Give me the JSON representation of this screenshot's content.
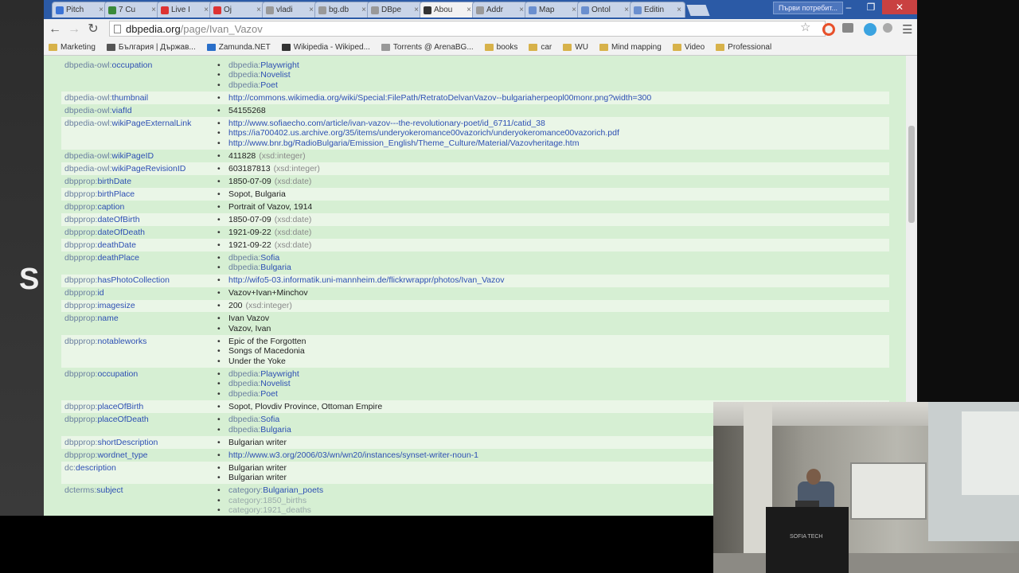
{
  "browser": {
    "tabs": [
      {
        "label": "Pitch",
        "icon_color": "#3b73d6"
      },
      {
        "label": "7 Cu",
        "icon_color": "#3a8a3a"
      },
      {
        "label": "Live I",
        "icon_color": "#d33"
      },
      {
        "label": "Oj",
        "icon_color": "#d33"
      },
      {
        "label": "vladi",
        "icon_color": "#999"
      },
      {
        "label": "bg.db",
        "icon_color": "#999"
      },
      {
        "label": "DBpe",
        "icon_color": "#999"
      },
      {
        "label": "Abou",
        "icon_color": "#333",
        "active": true
      },
      {
        "label": "Addr",
        "icon_color": "#999"
      },
      {
        "label": "Map",
        "icon_color": "#6a8fcf"
      },
      {
        "label": "Ontol",
        "icon_color": "#6a8fcf"
      },
      {
        "label": "Editin",
        "icon_color": "#6a8fcf"
      }
    ],
    "user_chip": "Първи потребит...",
    "url_host": "dbpedia.org",
    "url_path": "/page/Ivan_Vazov",
    "bookmarks": [
      {
        "label": "Marketing",
        "color": "#d7b24a"
      },
      {
        "label": "България | Държав...",
        "color": "#555"
      },
      {
        "label": "Zamunda.NET",
        "color": "#2a6fc9"
      },
      {
        "label": "Wikipedia - Wikiped...",
        "color": "#333"
      },
      {
        "label": "Torrents @ ArenaBG...",
        "color": "#999"
      },
      {
        "label": "books",
        "color": "#d7b24a"
      },
      {
        "label": "car",
        "color": "#d7b24a"
      },
      {
        "label": "WU",
        "color": "#d7b24a"
      },
      {
        "label": "Mind mapping",
        "color": "#d7b24a"
      },
      {
        "label": "Video",
        "color": "#d7b24a"
      },
      {
        "label": "Professional",
        "color": "#d7b24a"
      }
    ]
  },
  "slide_letter": "S",
  "podium_label": "SOFIA TECH",
  "rows": [
    {
      "prefix": "dbpedia-owl:",
      "local": "occupation",
      "values": [
        {
          "pre": "dbpedia:",
          "link": "Playwright"
        },
        {
          "pre": "dbpedia:",
          "link": "Novelist"
        },
        {
          "pre": "dbpedia:",
          "link": "Poet"
        }
      ]
    },
    {
      "prefix": "dbpedia-owl:",
      "local": "thumbnail",
      "values": [
        {
          "link": "http://commons.wikimedia.org/wiki/Special:FilePath/RetratoDelvanVazov--bulgariaherpeopl00monr.png?width=300"
        }
      ]
    },
    {
      "prefix": "dbpedia-owl:",
      "local": "viafId",
      "values": [
        {
          "text": "54155268"
        }
      ]
    },
    {
      "prefix": "dbpedia-owl:",
      "local": "wikiPageExternalLink",
      "values": [
        {
          "link": "http://www.sofiaecho.com/article/ivan-vazov---the-revolutionary-poet/id_6711/catid_38"
        },
        {
          "link": "https://ia700402.us.archive.org/35/items/underyokeromance00vazorich/underyokeromance00vazorich.pdf"
        },
        {
          "link": "http://www.bnr.bg/RadioBulgaria/Emission_English/Theme_Culture/Material/Vazovheritage.htm"
        }
      ]
    },
    {
      "prefix": "dbpedia-owl:",
      "local": "wikiPageID",
      "values": [
        {
          "text": "411828",
          "type": "(xsd:integer)"
        }
      ]
    },
    {
      "prefix": "dbpedia-owl:",
      "local": "wikiPageRevisionID",
      "values": [
        {
          "text": "603187813",
          "type": "(xsd:integer)"
        }
      ]
    },
    {
      "prefix": "dbpprop:",
      "local": "birthDate",
      "values": [
        {
          "text": "1850-07-09",
          "type": "(xsd:date)"
        }
      ]
    },
    {
      "prefix": "dbpprop:",
      "local": "birthPlace",
      "values": [
        {
          "text": "Sopot, Bulgaria"
        }
      ]
    },
    {
      "prefix": "dbpprop:",
      "local": "caption",
      "values": [
        {
          "text": "Portrait of Vazov, 1914"
        }
      ]
    },
    {
      "prefix": "dbpprop:",
      "local": "dateOfBirth",
      "values": [
        {
          "text": "1850-07-09",
          "type": "(xsd:date)"
        }
      ]
    },
    {
      "prefix": "dbpprop:",
      "local": "dateOfDeath",
      "values": [
        {
          "text": "1921-09-22",
          "type": "(xsd:date)"
        }
      ]
    },
    {
      "prefix": "dbpprop:",
      "local": "deathDate",
      "values": [
        {
          "text": "1921-09-22",
          "type": "(xsd:date)"
        }
      ]
    },
    {
      "prefix": "dbpprop:",
      "local": "deathPlace",
      "values": [
        {
          "pre": "dbpedia:",
          "link": "Sofia"
        },
        {
          "pre": "dbpedia:",
          "link": "Bulgaria"
        }
      ]
    },
    {
      "prefix": "dbpprop:",
      "local": "hasPhotoCollection",
      "values": [
        {
          "link": "http://wifo5-03.informatik.uni-mannheim.de/flickrwrappr/photos/Ivan_Vazov"
        }
      ]
    },
    {
      "prefix": "dbpprop:",
      "local": "id",
      "values": [
        {
          "text": "Vazov+Ivan+Minchov"
        }
      ]
    },
    {
      "prefix": "dbpprop:",
      "local": "imagesize",
      "values": [
        {
          "text": "200",
          "type": "(xsd:integer)"
        }
      ]
    },
    {
      "prefix": "dbpprop:",
      "local": "name",
      "values": [
        {
          "text": "Ivan Vazov"
        },
        {
          "text": "Vazov, Ivan"
        }
      ]
    },
    {
      "prefix": "dbpprop:",
      "local": "notableworks",
      "values": [
        {
          "text": "Epic of the Forgotten"
        },
        {
          "text": "Songs of Macedonia"
        },
        {
          "text": "Under the Yoke"
        }
      ]
    },
    {
      "prefix": "dbpprop:",
      "local": "occupation",
      "values": [
        {
          "pre": "dbpedia:",
          "link": "Playwright"
        },
        {
          "pre": "dbpedia:",
          "link": "Novelist"
        },
        {
          "pre": "dbpedia:",
          "link": "Poet"
        }
      ]
    },
    {
      "prefix": "dbpprop:",
      "local": "placeOfBirth",
      "values": [
        {
          "text": "Sopot, Plovdiv Province, Ottoman Empire"
        }
      ]
    },
    {
      "prefix": "dbpprop:",
      "local": "placeOfDeath",
      "values": [
        {
          "pre": "dbpedia:",
          "link": "Sofia"
        },
        {
          "pre": "dbpedia:",
          "link": "Bulgaria"
        }
      ]
    },
    {
      "prefix": "dbpprop:",
      "local": "shortDescription",
      "values": [
        {
          "text": "Bulgarian writer"
        }
      ]
    },
    {
      "prefix": "dbpprop:",
      "local": "wordnet_type",
      "values": [
        {
          "link": "http://www.w3.org/2006/03/wn/wn20/instances/synset-writer-noun-1"
        }
      ]
    },
    {
      "prefix": "dc:",
      "local": "description",
      "values": [
        {
          "text": "Bulgarian writer"
        },
        {
          "text": "Bulgarian writer"
        }
      ]
    },
    {
      "prefix": "dcterms:",
      "local": "subject",
      "values": [
        {
          "pre": "category:",
          "link": "Bulgarian_poets"
        },
        {
          "grey": "category:1850_births"
        },
        {
          "grey": "category:1921_deaths"
        }
      ]
    }
  ]
}
